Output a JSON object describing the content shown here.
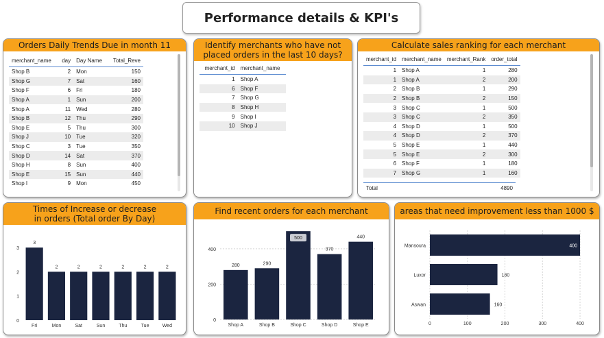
{
  "page_title": "Performance details & KPI's",
  "orders_daily": {
    "title": "Orders Daily Trends Due in month 11",
    "columns": [
      "merchant_name",
      "day",
      "Day Name",
      "Total_Reve"
    ],
    "rows": [
      [
        "Shop B",
        "2",
        "Mon",
        "150"
      ],
      [
        "Shop G",
        "7",
        "Sat",
        "160"
      ],
      [
        "Shop F",
        "6",
        "Fri",
        "180"
      ],
      [
        "Shop A",
        "1",
        "Sun",
        "200"
      ],
      [
        "Shop A",
        "11",
        "Wed",
        "280"
      ],
      [
        "Shop B",
        "12",
        "Thu",
        "290"
      ],
      [
        "Shop E",
        "5",
        "Thu",
        "300"
      ],
      [
        "Shop J",
        "10",
        "Tue",
        "320"
      ],
      [
        "Shop C",
        "3",
        "Tue",
        "350"
      ],
      [
        "Shop D",
        "14",
        "Sat",
        "370"
      ],
      [
        "Shop H",
        "8",
        "Sun",
        "400"
      ],
      [
        "Shop E",
        "15",
        "Sun",
        "440"
      ],
      [
        "Shop I",
        "9",
        "Mon",
        "450"
      ]
    ]
  },
  "no_orders": {
    "title": "Identify merchants who have not placed orders in the last 10 days?",
    "columns": [
      "merchant_id",
      "merchant_name"
    ],
    "rows": [
      [
        "1",
        "Shop A"
      ],
      [
        "6",
        "Shop F"
      ],
      [
        "7",
        "Shop G"
      ],
      [
        "8",
        "Shop H"
      ],
      [
        "9",
        "Shop I"
      ],
      [
        "10",
        "Shop J"
      ]
    ]
  },
  "sales_ranking": {
    "title": "Calculate sales ranking for each merchant",
    "columns": [
      "merchant_id",
      "merchant_name",
      "merchant_Rank",
      "order_total"
    ],
    "rows": [
      [
        "1",
        "Shop A",
        "1",
        "280"
      ],
      [
        "1",
        "Shop A",
        "2",
        "200"
      ],
      [
        "2",
        "Shop B",
        "1",
        "290"
      ],
      [
        "2",
        "Shop B",
        "2",
        "150"
      ],
      [
        "3",
        "Shop C",
        "1",
        "500"
      ],
      [
        "3",
        "Shop C",
        "2",
        "350"
      ],
      [
        "4",
        "Shop D",
        "1",
        "500"
      ],
      [
        "4",
        "Shop D",
        "2",
        "370"
      ],
      [
        "5",
        "Shop E",
        "1",
        "440"
      ],
      [
        "5",
        "Shop E",
        "2",
        "300"
      ],
      [
        "6",
        "Shop F",
        "1",
        "180"
      ],
      [
        "7",
        "Shop G",
        "1",
        "160"
      ]
    ],
    "total_label": "Total",
    "total_value": "4890"
  },
  "chart_data": [
    {
      "type": "bar",
      "title": "Times of Increase or decrease in orders (Total order By Day)",
      "categories": [
        "Fri",
        "Mon",
        "Sat",
        "Sun",
        "Thu",
        "Tue",
        "Wed"
      ],
      "values": [
        3,
        2,
        2,
        2,
        2,
        2,
        2
      ],
      "yticks": [
        0,
        1,
        2,
        3
      ],
      "ylim": [
        0,
        3.2
      ],
      "bar_color": "#1b2540"
    },
    {
      "type": "bar",
      "title": "Find recent orders for each merchant",
      "categories": [
        "Shop A",
        "Shop B",
        "Shop C",
        "Shop D",
        "Shop E"
      ],
      "values": [
        280,
        290,
        500,
        370,
        440
      ],
      "yticks": [
        0,
        200,
        400
      ],
      "ylim": [
        0,
        520
      ],
      "highlighted": "Shop C",
      "bar_color": "#1b2540"
    },
    {
      "type": "bar",
      "orientation": "horizontal",
      "title": "areas that need improvement less than 1000 $",
      "categories": [
        "Mansoura",
        "Luxor",
        "Aswan"
      ],
      "values": [
        400,
        180,
        160
      ],
      "xticks": [
        0,
        100,
        200,
        300,
        400
      ],
      "xlim": [
        0,
        420
      ],
      "bar_color": "#1b2540"
    }
  ]
}
